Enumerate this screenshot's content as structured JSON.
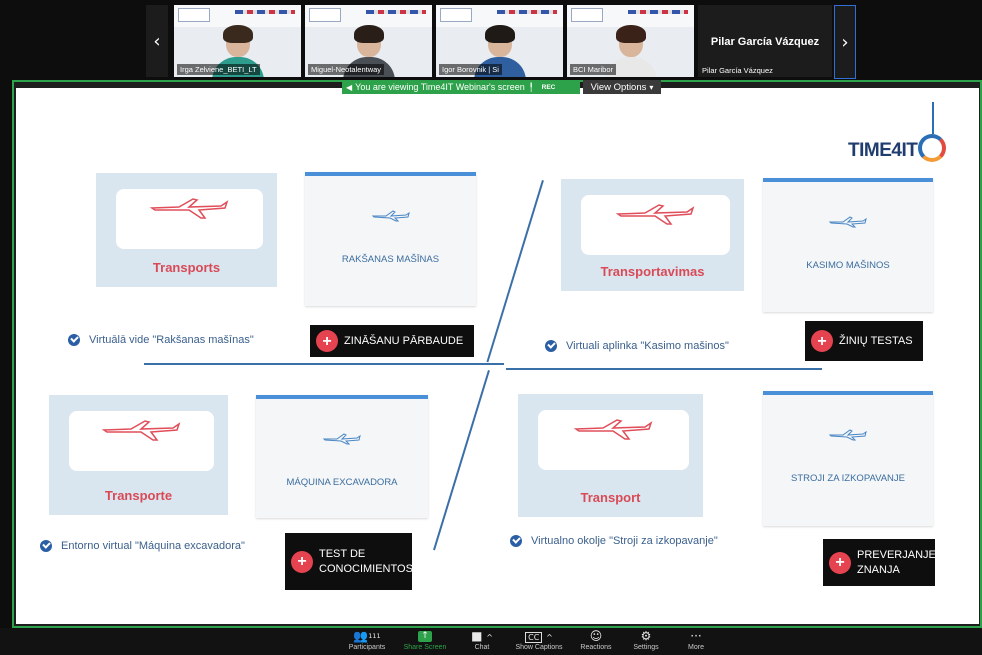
{
  "participants": [
    {
      "name": "Irga Zelviene_BETI_LT",
      "hair": "#3a2a1e",
      "shirt": "#2e9d8e"
    },
    {
      "name": "Miguel-Neotalentway",
      "hair": "#2a1f18",
      "shirt": "#4a4f56"
    },
    {
      "name": "Igor Borovnik | Si",
      "hair": "#1f1a16",
      "shirt": "#2f5f9e"
    },
    {
      "name": "BCI Maribor",
      "hair": "#3b2218",
      "shirt": "#e8e8e8"
    }
  ],
  "active_speaker": {
    "display": "Pilar García Vázquez",
    "label": "Pilar García Vázquez"
  },
  "banner": {
    "text": "You are viewing Time4IT Webinar's screen",
    "rec": "REC",
    "view_options": "View Options"
  },
  "slide": {
    "logo": "TIME4IT",
    "blocks": [
      {
        "transport": "Transports",
        "machine": "RAKŠANAS MAŠĪNAS",
        "env": "Virtuālā vide \"Rakšanas mašīnas\"",
        "quiz": "ZINĀŠANU PĀRBAUDE"
      },
      {
        "transport": "Transportavimas",
        "machine": "KASIMO MAŠINOS",
        "env": "Virtuali aplinka \"Kasimo mašinos\"",
        "quiz": "ŽINIŲ TESTAS"
      },
      {
        "transport": "Transporte",
        "machine": "MÁQUINA EXCAVADORA",
        "env": "Entorno virtual \"Máquina excavadora\"",
        "quiz_line1": "TEST DE",
        "quiz_line2": "CONOCIMIENTOS"
      },
      {
        "transport": "Transport",
        "machine": "STROJI ZA IZKOPAVANJE",
        "env": "Virtualno okolje \"Stroji za izkopavanje\"",
        "quiz_line1": "PREVERJANJE",
        "quiz_line2": "ZNANJA"
      }
    ]
  },
  "toolbar": {
    "participants": "Participants",
    "participants_count": "111",
    "share": "Share Screen",
    "chat": "Chat",
    "captions": "Show Captions",
    "reactions": "Reactions",
    "settings": "Settings",
    "more": "More"
  },
  "colors": {
    "accent_green": "#2ea24a",
    "slide_blue": "#3a6fa8",
    "transport_red": "#d94a56"
  }
}
